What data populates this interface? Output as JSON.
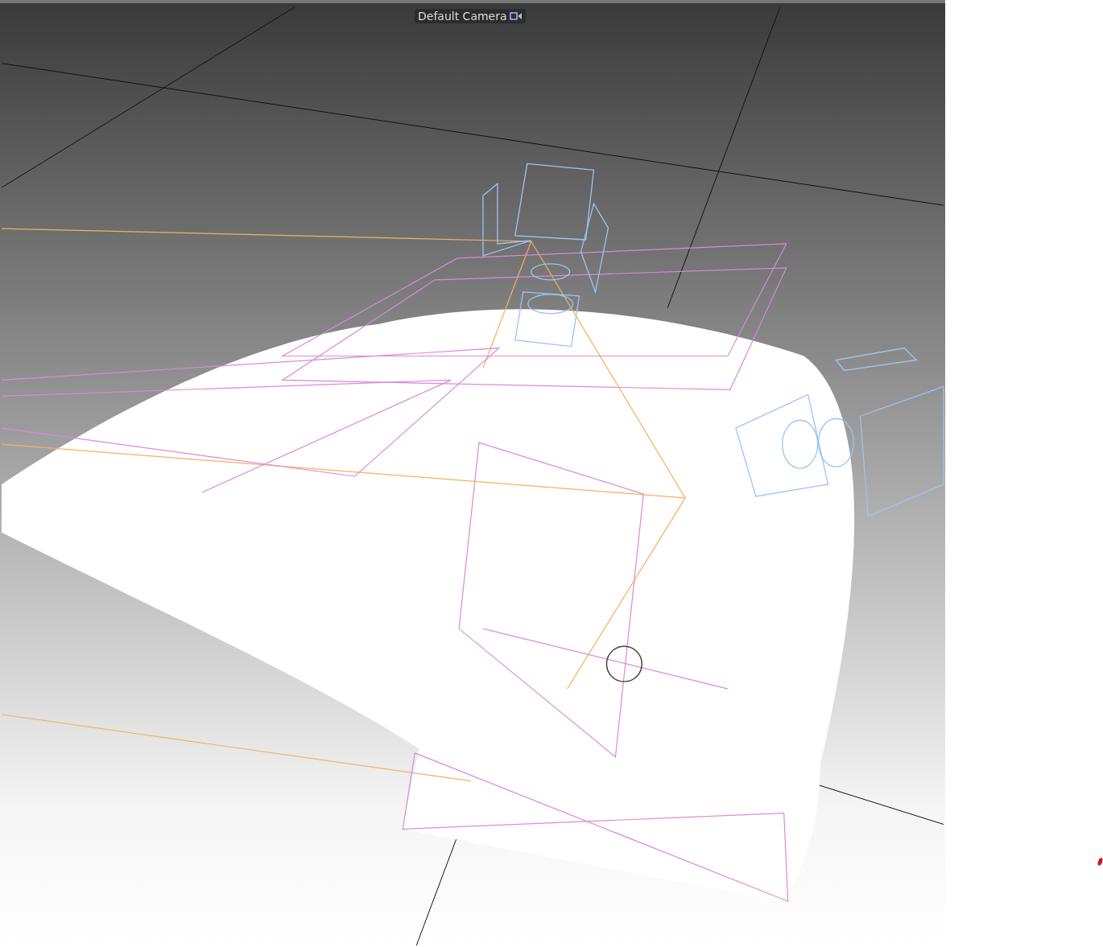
{
  "viewport": {
    "camera_label": "Default Camera"
  }
}
